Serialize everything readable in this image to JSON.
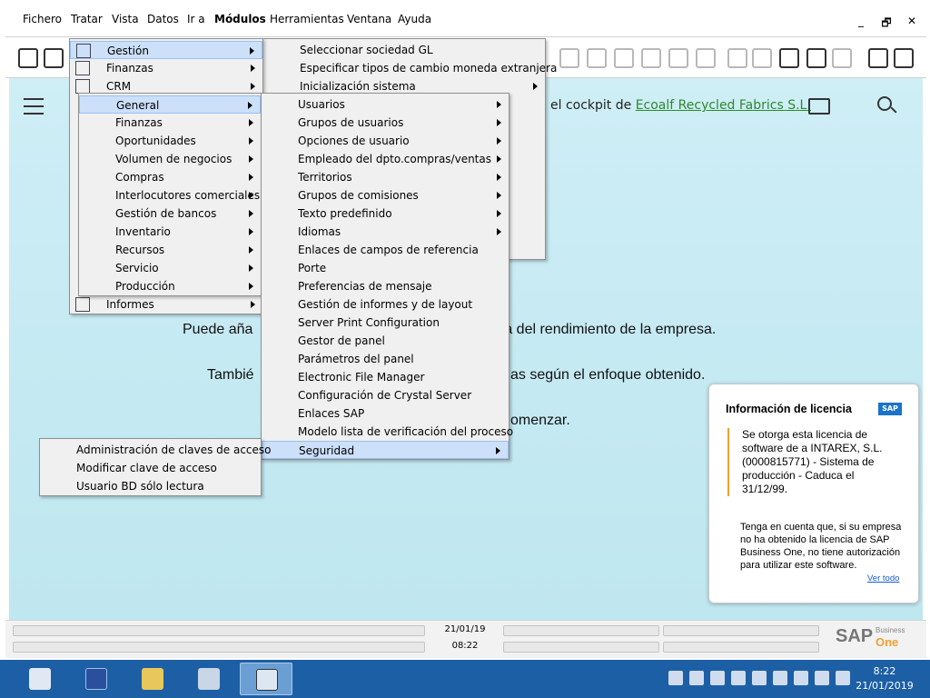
{
  "menubar": {
    "items": [
      "Fichero",
      "Tratar",
      "Vista",
      "Datos",
      "Ir a",
      "Módulos",
      "Herramientas",
      "Ventana",
      "Ayuda"
    ],
    "window_controls": [
      "_",
      "🗗",
      "✕"
    ]
  },
  "cockpit": {
    "welcome_prefix": "el cockpit de",
    "company": "Ecoalf Recycled Fabrics S.L.",
    "line1_left": "Puede aña",
    "line1_right": "ra del rendimiento de la empresa.",
    "line2_left": "Tambié",
    "line2_right": "as según el enfoque obtenido.",
    "line3_right": "omenzar."
  },
  "modules_menu": {
    "items": [
      "Gestión",
      "Finanzas",
      "CRM",
      "Informes"
    ]
  },
  "gestion_menu": {
    "items": [
      "Seleccionar sociedad GL",
      "Especificar tipos de cambio moneda extranjera",
      "Inicialización sistema"
    ]
  },
  "gestion_sub": {
    "items": [
      "General",
      "Finanzas",
      "Oportunidades",
      "Volumen de negocios",
      "Compras",
      "Interlocutores comerciales",
      "Gestión de bancos",
      "Inventario",
      "Recursos",
      "Servicio",
      "Producción"
    ]
  },
  "general_menu": {
    "items": [
      "Usuarios",
      "Grupos de usuarios",
      "Opciones de usuario",
      "Empleado del dpto.compras/ventas",
      "Territorios",
      "Grupos de comisiones",
      "Texto predefinido",
      "Idiomas",
      "Enlaces de campos de referencia",
      "Porte",
      "Preferencias de mensaje",
      "Gestión de informes y de layout",
      "Server Print Configuration",
      "Gestor de panel",
      "Parámetros del panel",
      "Electronic File Manager",
      "Configuración de Crystal Server",
      "Enlaces SAP",
      "Modelo lista de verificación del proceso",
      "Seguridad"
    ]
  },
  "seguridad_menu": {
    "items": [
      "Administración de claves de acceso",
      "Modificar clave de acceso",
      "Usuario BD sólo lectura"
    ]
  },
  "license": {
    "title": "Información de licencia",
    "logo": "SAP",
    "body": "Se otorga esta licencia de software de a INTAREX, S.L. (0000815771) - Sistema de producción - Caduca el 31/12/99.",
    "note": "Tenga en cuenta que, si su empresa no ha obtenido la licencia de SAP Business One, no tiene autorización para utilizar este software.",
    "link": "Ver todo"
  },
  "status": {
    "date": "21/01/19",
    "time": "08:22",
    "brand_name": "SAP",
    "brand_sub": "Business",
    "brand_one": "One"
  },
  "taskbar": {
    "clock_time": "8:22",
    "clock_date": "21/01/2019"
  },
  "colors": {
    "accent": "#1c5fa5",
    "menu_highlight": "#cce0fa",
    "link_green": "#2d8a2d",
    "license_bar": "#f0a030"
  }
}
